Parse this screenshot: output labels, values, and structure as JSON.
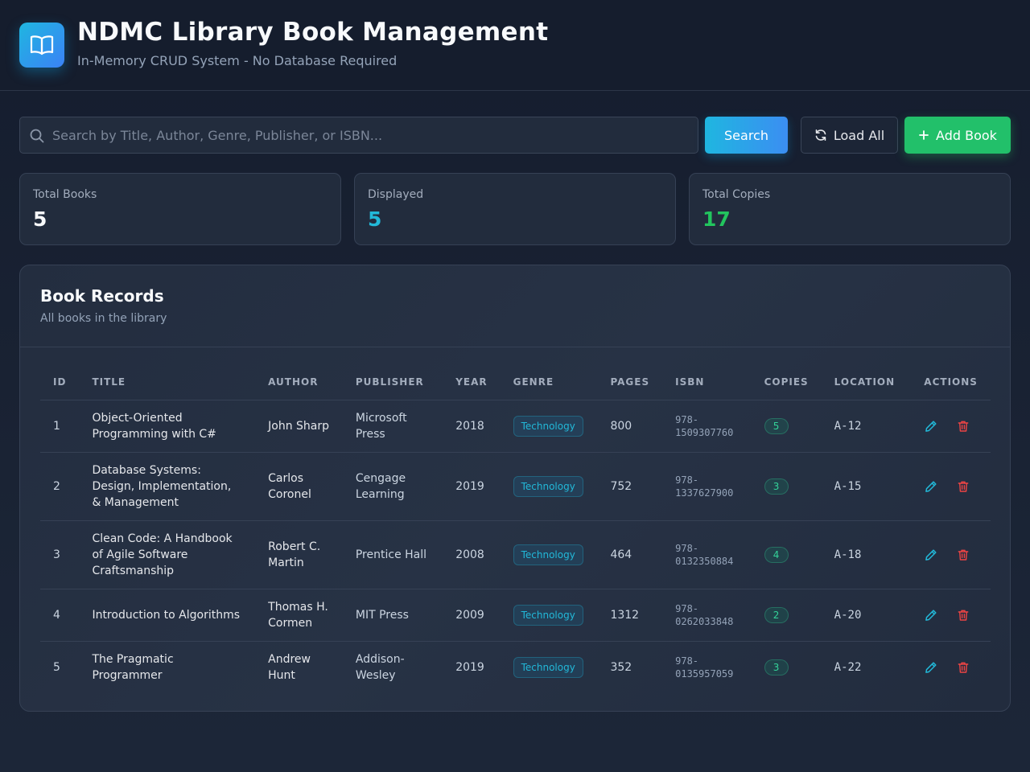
{
  "header": {
    "title": "NDMC Library Book Management",
    "subtitle": "In-Memory CRUD System - No Database Required",
    "logo_icon": "open-book-icon"
  },
  "toolbar": {
    "search_placeholder": "Search by Title, Author, Genre, Publisher, or ISBN...",
    "search_value": "",
    "search_label": "Search",
    "load_all_label": "Load All",
    "add_book_label": "Add Book"
  },
  "stats": [
    {
      "label": "Total Books",
      "value": "5",
      "color": "#f8fafc"
    },
    {
      "label": "Displayed",
      "value": "5",
      "color": "#22b8d8"
    },
    {
      "label": "Total Copies",
      "value": "17",
      "color": "#22c55e"
    }
  ],
  "panel": {
    "title": "Book Records",
    "subtitle": "All books in the library"
  },
  "table": {
    "columns": [
      "ID",
      "TITLE",
      "AUTHOR",
      "PUBLISHER",
      "YEAR",
      "GENRE",
      "PAGES",
      "ISBN",
      "COPIES",
      "LOCATION",
      "ACTIONS"
    ],
    "rows": [
      {
        "id": "1",
        "title": "Object-Oriented Programming with C#",
        "author": "John Sharp",
        "publisher": "Microsoft Press",
        "year": "2018",
        "genre": "Technology",
        "pages": "800",
        "isbn": "978-1509307760",
        "copies": "5",
        "location": "A-12"
      },
      {
        "id": "2",
        "title": "Database Systems: Design, Implementation, & Management",
        "author": "Carlos Coronel",
        "publisher": "Cengage Learning",
        "year": "2019",
        "genre": "Technology",
        "pages": "752",
        "isbn": "978-1337627900",
        "copies": "3",
        "location": "A-15"
      },
      {
        "id": "3",
        "title": "Clean Code: A Handbook of Agile Software Craftsmanship",
        "author": "Robert C. Martin",
        "publisher": "Prentice Hall",
        "year": "2008",
        "genre": "Technology",
        "pages": "464",
        "isbn": "978-0132350884",
        "copies": "4",
        "location": "A-18"
      },
      {
        "id": "4",
        "title": "Introduction to Algorithms",
        "author": "Thomas H. Cormen",
        "publisher": "MIT Press",
        "year": "2009",
        "genre": "Technology",
        "pages": "1312",
        "isbn": "978-0262033848",
        "copies": "2",
        "location": "A-20"
      },
      {
        "id": "5",
        "title": "The Pragmatic Programmer",
        "author": "Andrew Hunt",
        "publisher": "Addison-Wesley",
        "year": "2019",
        "genre": "Technology",
        "pages": "352",
        "isbn": "978-0135957059",
        "copies": "3",
        "location": "A-22"
      }
    ]
  },
  "icons": {
    "search": "search-icon",
    "load": "refresh-icon",
    "add": "plus-icon",
    "edit": "pencil-icon",
    "delete": "trash-icon"
  },
  "colors": {
    "accent": "#1fb6e0",
    "success": "#22c06a",
    "danger": "#ef4444"
  }
}
